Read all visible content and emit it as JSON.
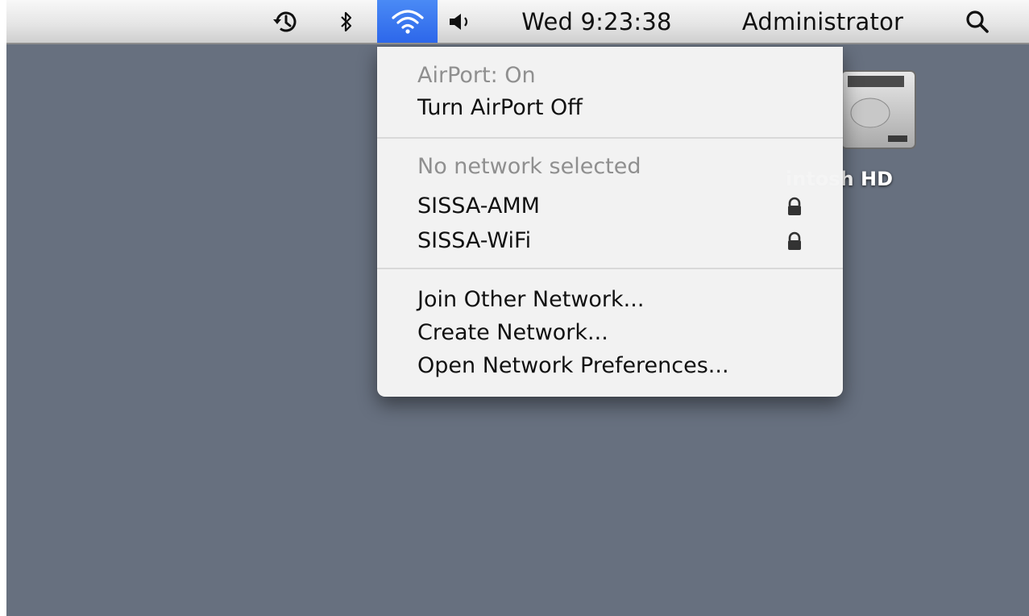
{
  "menubar": {
    "icons": [
      "time-machine-icon",
      "bluetooth-icon",
      "airport-wifi-icon",
      "volume-icon",
      "spotlight-search-icon"
    ],
    "clock": "Wed 9:23:38",
    "user": "Administrator",
    "accent_color": "#3a78f0"
  },
  "desktop": {
    "disk_label": "intosh HD"
  },
  "airport_menu": {
    "status": "AirPort: On",
    "toggle_label": "Turn AirPort Off",
    "network_header": "No network selected",
    "networks": [
      {
        "name": "SISSA-AMM",
        "icon": "lock-icon"
      },
      {
        "name": "SISSA-WiFi",
        "icon": "lock-icon"
      }
    ],
    "join_other": "Join Other Network...",
    "create_network": "Create Network...",
    "open_preferences": "Open Network Preferences..."
  }
}
